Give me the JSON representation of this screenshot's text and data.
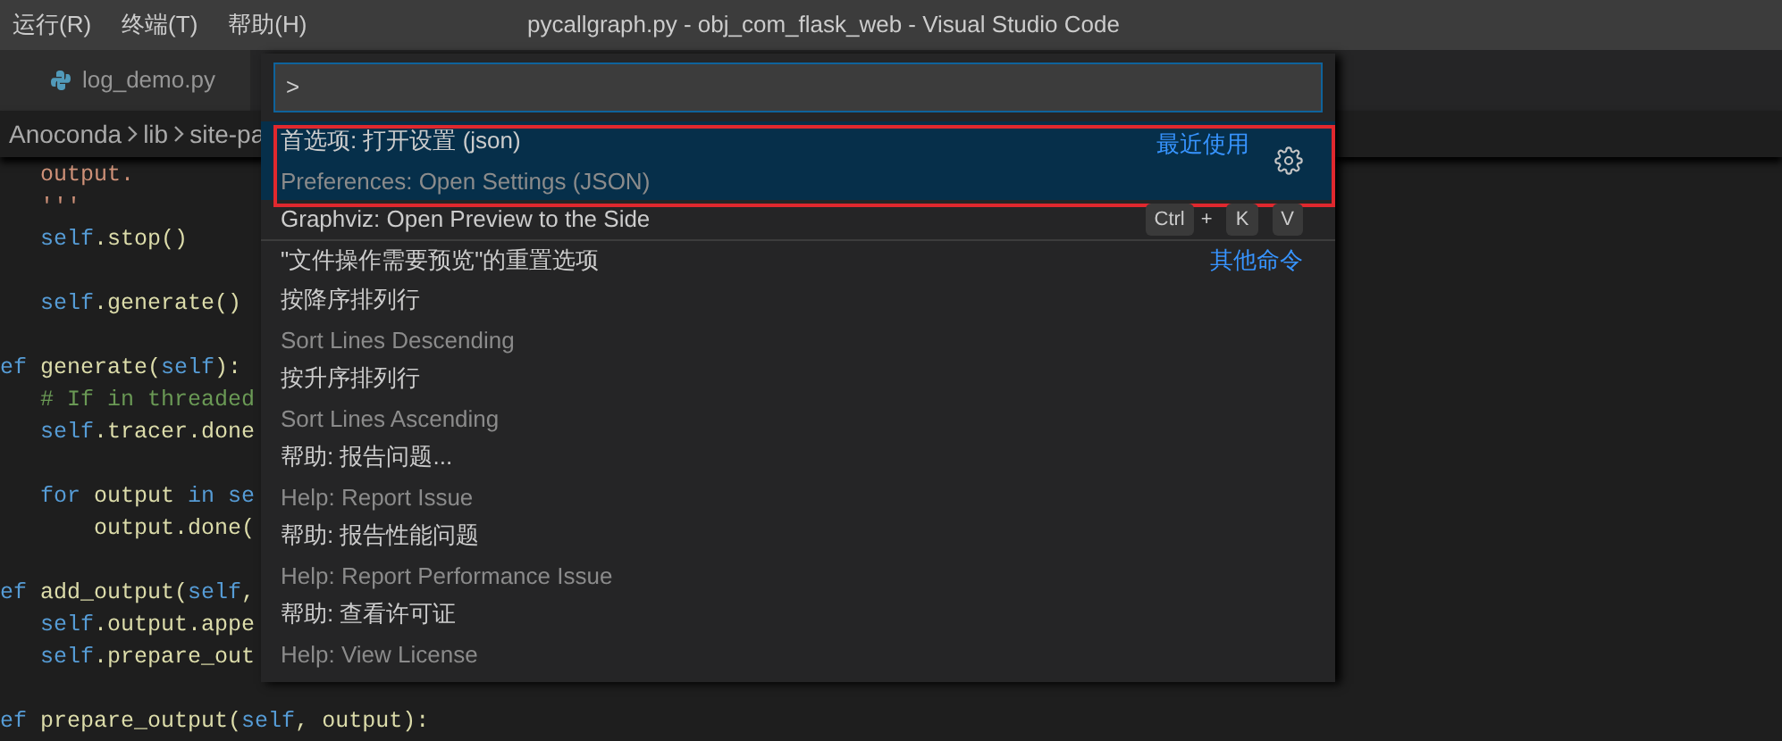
{
  "menu": [
    "运行(R)",
    "终端(T)",
    "帮助(H)"
  ],
  "window": {
    "title": "pycallgraph.py - obj_com_flask_web - Visual Studio Code"
  },
  "tabs": [
    {
      "label": "log_demo.py",
      "selected": false
    }
  ],
  "breadcrumb": [
    "Anoconda",
    "lib",
    "site-pa"
  ],
  "code": [
    {
      "kind": "code",
      "tokens": [
        {
          "kind": "string",
          "text": "   output."
        }
      ]
    },
    {
      "kind": "code",
      "tokens": [
        {
          "kind": "string",
          "text": "   '''"
        }
      ]
    },
    {
      "kind": "code",
      "tokens": [
        {
          "kind": "self",
          "text": "   self"
        },
        {
          "kind": "plain",
          "text": ".stop()"
        }
      ]
    },
    {
      "kind": "blank"
    },
    {
      "kind": "code",
      "tokens": [
        {
          "kind": "self",
          "text": "   self"
        },
        {
          "kind": "plain",
          "text": ".generate()"
        }
      ]
    },
    {
      "kind": "blank"
    },
    {
      "kind": "code",
      "tokens": [
        {
          "kind": "keyword",
          "text": "ef"
        },
        {
          "kind": "plain",
          "text": " generate("
        },
        {
          "kind": "self",
          "text": "self"
        },
        {
          "kind": "plain",
          "text": "):"
        }
      ]
    },
    {
      "kind": "code",
      "tokens": [
        {
          "kind": "comment",
          "text": "   # If in threaded"
        }
      ]
    },
    {
      "kind": "code",
      "tokens": [
        {
          "kind": "self",
          "text": "   self"
        },
        {
          "kind": "plain",
          "text": ".tracer.done"
        }
      ]
    },
    {
      "kind": "blank"
    },
    {
      "kind": "code",
      "tokens": [
        {
          "kind": "keyword",
          "text": "   for"
        },
        {
          "kind": "plain",
          "text": " output "
        },
        {
          "kind": "keyword",
          "text": "in"
        },
        {
          "kind": "self",
          "text": " se"
        }
      ]
    },
    {
      "kind": "code",
      "tokens": [
        {
          "kind": "plain",
          "text": "       output.done("
        }
      ]
    },
    {
      "kind": "blank"
    },
    {
      "kind": "code",
      "tokens": [
        {
          "kind": "keyword",
          "text": "ef"
        },
        {
          "kind": "plain",
          "text": " add_output("
        },
        {
          "kind": "self",
          "text": "self"
        },
        {
          "kind": "plain",
          "text": ","
        }
      ]
    },
    {
      "kind": "code",
      "tokens": [
        {
          "kind": "self",
          "text": "   self"
        },
        {
          "kind": "plain",
          "text": ".output.appe"
        }
      ]
    },
    {
      "kind": "code",
      "tokens": [
        {
          "kind": "self",
          "text": "   self"
        },
        {
          "kind": "plain",
          "text": ".prepare_out"
        }
      ]
    },
    {
      "kind": "blank"
    },
    {
      "kind": "code",
      "tokens": [
        {
          "kind": "keyword",
          "text": "ef"
        },
        {
          "kind": "plain",
          "text": " prepare_output("
        },
        {
          "kind": "self",
          "text": "self"
        },
        {
          "kind": "plain",
          "text": ", output):"
        }
      ]
    }
  ],
  "palette": {
    "input": ">",
    "items": [
      {
        "label": "首选项: 打开设置 (json)",
        "detail": "Preferences: Open Settings (JSON)",
        "group": "最近使用",
        "selected": true
      },
      {
        "label": "Graphviz: Open Preview to the Side",
        "keybinding": [
          {
            "kind": "key",
            "text": "Ctrl"
          },
          {
            "kind": "plus",
            "text": "+"
          },
          {
            "kind": "key",
            "text": "K"
          },
          {
            "kind": "key",
            "text": "V"
          }
        ],
        "selected": false
      },
      {
        "label": "\"文件操作需要预览\"的重置选项",
        "group": "其他命令",
        "separator": true,
        "selected": false
      },
      {
        "label": "按降序排列行",
        "detail": "Sort Lines Descending",
        "selected": false
      },
      {
        "label": "按升序排列行",
        "detail": "Sort Lines Ascending",
        "selected": false
      },
      {
        "label": "帮助: 报告问题...",
        "detail": "Help: Report Issue",
        "selected": false
      },
      {
        "label": "帮助: 报告性能问题",
        "detail": "Help: Report Performance Issue",
        "selected": false
      },
      {
        "label": "帮助: 查看许可证",
        "detail": "Help: View License",
        "selected": false
      }
    ]
  }
}
